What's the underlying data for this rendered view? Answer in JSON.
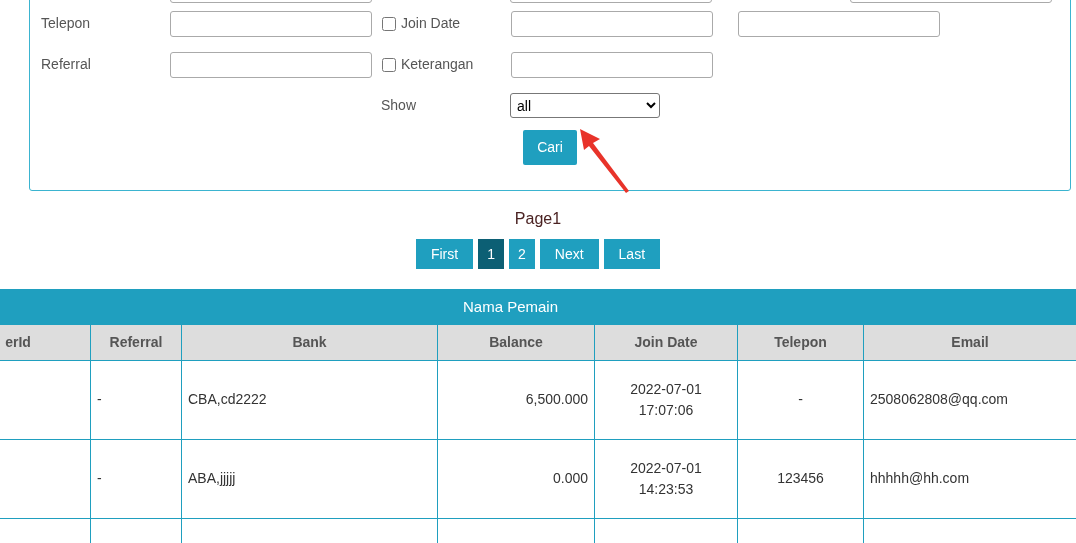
{
  "search_form": {
    "hidden_row": [
      {
        "kind": "input"
      },
      {
        "kind": "input"
      },
      {
        "kind": "input"
      }
    ],
    "rows": [
      {
        "label": "Telepon",
        "checkbox": {
          "label": "Join Date",
          "checked": false
        },
        "inputs": [
          {
            "kind": "input"
          },
          {
            "kind": "input"
          }
        ]
      },
      {
        "label": "Referral",
        "checkbox": {
          "label": "Keterangan",
          "checked": false
        },
        "inputs": [
          {
            "kind": "input"
          }
        ]
      }
    ],
    "show": {
      "label": "Show",
      "value": "all"
    },
    "submit": "Cari"
  },
  "page_label": "Page1",
  "pagination": [
    {
      "label": "First",
      "selected": false
    },
    {
      "label": "1",
      "selected": true
    },
    {
      "label": "2",
      "selected": false
    },
    {
      "label": "Next",
      "selected": false
    },
    {
      "label": "Last",
      "selected": false
    }
  ],
  "table": {
    "title": "Nama Pemain",
    "columns": [
      "erId",
      "Referral",
      "Bank",
      "Balance",
      "Join Date",
      "Telepon",
      "Email"
    ],
    "rows": [
      {
        "cells": [
          "",
          "-",
          "CBA,cd2222",
          "6,500.000",
          "2022-07-01\n17:07:06",
          "-",
          "2508062808@qq.com"
        ]
      },
      {
        "cells": [
          "",
          "-",
          "ABA,jjjjj",
          "0.000",
          "2022-07-01\n14:23:53",
          "123456",
          "hhhhh@hh.com"
        ]
      },
      {
        "cells": [
          "",
          "",
          "",
          "",
          "",
          "",
          ""
        ]
      }
    ]
  }
}
